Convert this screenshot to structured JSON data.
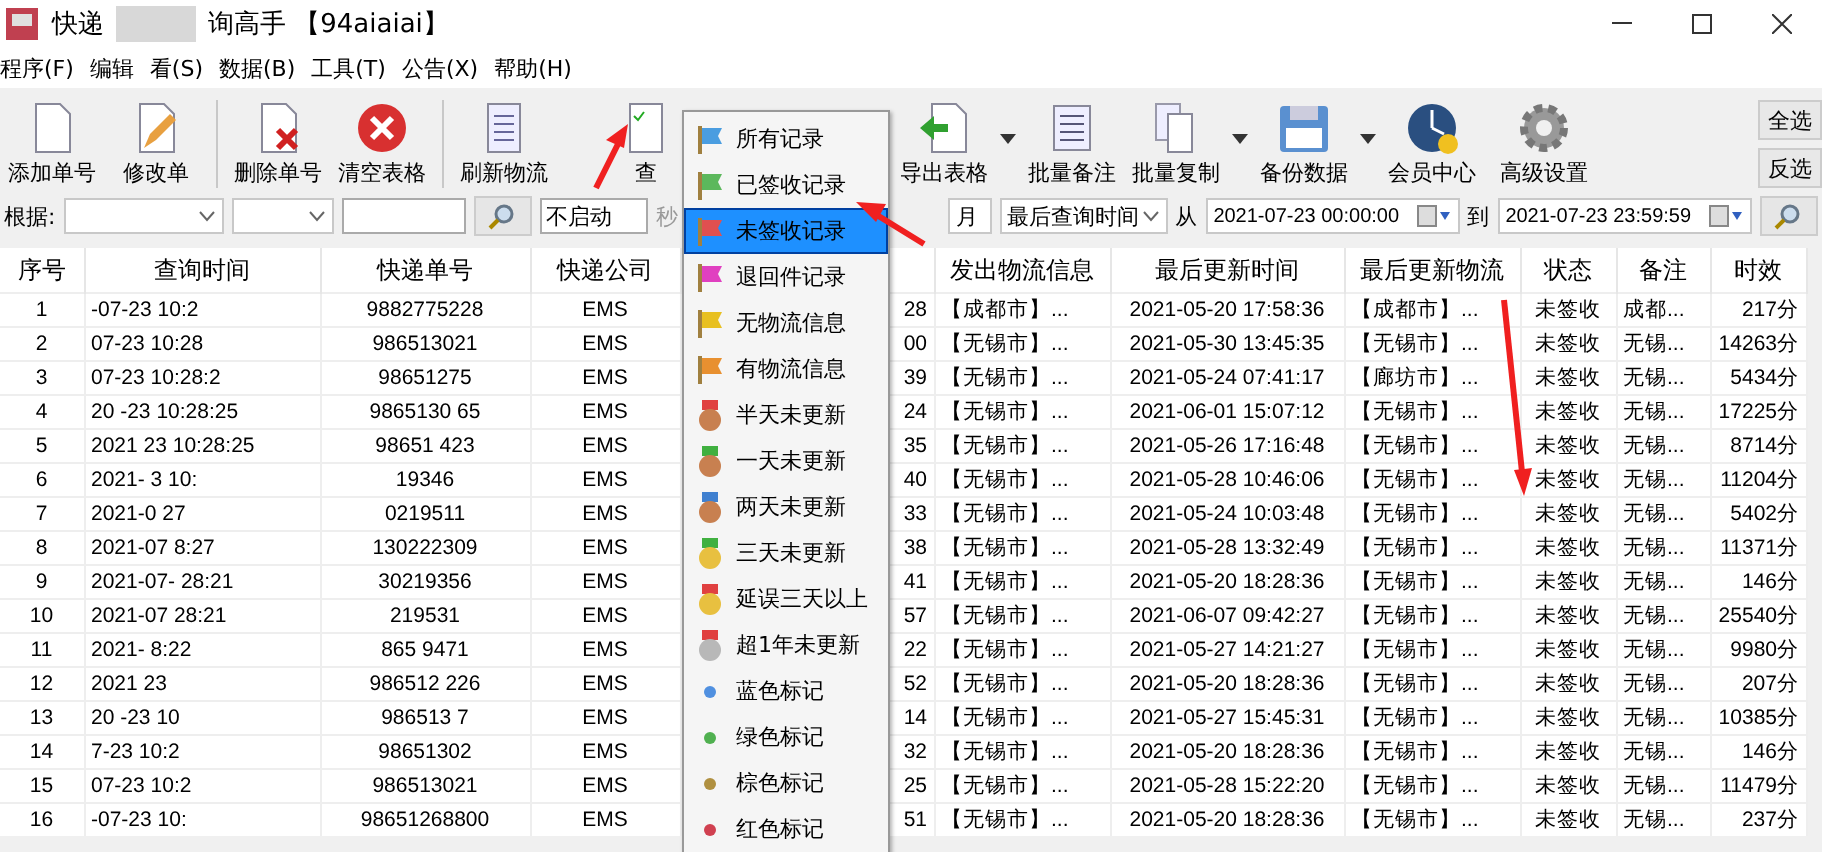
{
  "window": {
    "title_left": "快递",
    "title_right": "询高手 【94aiaiai】"
  },
  "menu_bar": [
    "程序(F)",
    "编辑",
    "看(S)",
    "数据(B)",
    "工具(T)",
    "公告(X)",
    "帮助(H)"
  ],
  "toolbar": {
    "buttons": [
      {
        "kind": "page",
        "label": "添加单号",
        "dropdown": false
      },
      {
        "kind": "edit",
        "label": "修改单",
        "dropdown": false
      },
      {
        "kind": "separator"
      },
      {
        "kind": "delete",
        "label": "删除单号",
        "dropdown": false
      },
      {
        "kind": "clear",
        "label": "清空表格",
        "dropdown": false
      },
      {
        "kind": "separator"
      },
      {
        "kind": "list",
        "label": "刷新物流",
        "dropdown": false
      },
      {
        "kind": "check",
        "label": "查",
        "dropdown": false
      },
      {
        "kind": "export",
        "label": "导出表格",
        "dropdown": true
      },
      {
        "kind": "scroll",
        "label": "批量备注",
        "dropdown": false
      },
      {
        "kind": "copy",
        "label": "批量复制",
        "dropdown": true
      },
      {
        "kind": "save",
        "label": "备份数据",
        "dropdown": true
      },
      {
        "kind": "clock",
        "label": "会员中心",
        "dropdown": false
      },
      {
        "kind": "gear",
        "label": "高级设置",
        "dropdown": false
      }
    ],
    "side_buttons": [
      "全选",
      "反选"
    ]
  },
  "filter": {
    "label": "根据:",
    "start_value": "不启动",
    "seconds_label": "秒",
    "month_value": "月",
    "time_field": "最后查询时间",
    "from_label": "从",
    "from_value": "2021-07-23 00:00:00",
    "to_label": "到",
    "to_value": "2021-07-23 23:59:59"
  },
  "table": {
    "columns": [
      "序号",
      "查询时间",
      "快递单号",
      "快递公司",
      "",
      "发出物流信息",
      "最后更新时间",
      "最后更新物流",
      "状态",
      "备注",
      "时效"
    ],
    "rows": [
      [
        "1",
        "-07-23 10:2",
        "9882775228",
        "EMS",
        "28",
        "【成都市】...",
        "2021-05-20 17:58:36",
        "【成都市】...",
        "未签收",
        "成都...",
        "217分"
      ],
      [
        "2",
        "07-23 10:28",
        "986513021",
        "EMS",
        "00",
        "【无锡市】...",
        "2021-05-30 13:45:35",
        "【无锡市】...",
        "未签收",
        "无锡...",
        "14263分"
      ],
      [
        "3",
        "07-23 10:28:2",
        "98651275",
        "EMS",
        "39",
        "【无锡市】...",
        "2021-05-24 07:41:17",
        "【廊坊市】...",
        "未签收",
        "无锡...",
        "5434分"
      ],
      [
        "4",
        "20 -23 10:28:25",
        "9865130 65",
        "EMS",
        "24",
        "【无锡市】...",
        "2021-06-01 15:07:12",
        "【无锡市】...",
        "未签收",
        "无锡...",
        "17225分"
      ],
      [
        "5",
        "2021 23 10:28:25",
        "98651 423",
        "EMS",
        "35",
        "【无锡市】...",
        "2021-05-26 17:16:48",
        "【无锡市】...",
        "未签收",
        "无锡...",
        "8714分"
      ],
      [
        "6",
        "2021- 3 10:",
        "19346",
        "EMS",
        "40",
        "【无锡市】...",
        "2021-05-28 10:46:06",
        "【无锡市】...",
        "未签收",
        "无锡...",
        "11204分"
      ],
      [
        "7",
        "2021-0 27",
        "0219511",
        "EMS",
        "33",
        "【无锡市】...",
        "2021-05-24 10:03:48",
        "【无锡市】...",
        "未签收",
        "无锡...",
        "5402分"
      ],
      [
        "8",
        "2021-07 8:27",
        "130222309",
        "EMS",
        "38",
        "【无锡市】...",
        "2021-05-28 13:32:49",
        "【无锡市】...",
        "未签收",
        "无锡...",
        "11371分"
      ],
      [
        "9",
        "2021-07- 28:21",
        "30219356",
        "EMS",
        "41",
        "【无锡市】...",
        "2021-05-20 18:28:36",
        "【无锡市】...",
        "未签收",
        "无锡...",
        "146分"
      ],
      [
        "10",
        "2021-07 28:21",
        "219531",
        "EMS",
        "57",
        "【无锡市】...",
        "2021-06-07 09:42:27",
        "【无锡市】...",
        "未签收",
        "无锡...",
        "25540分"
      ],
      [
        "11",
        "2021- 8:22",
        "865 9471",
        "EMS",
        "22",
        "【无锡市】...",
        "2021-05-27 14:21:27",
        "【无锡市】...",
        "未签收",
        "无锡...",
        "9980分"
      ],
      [
        "12",
        "2021 23",
        "986512 226",
        "EMS",
        "52",
        "【无锡市】...",
        "2021-05-20 18:28:36",
        "【无锡市】...",
        "未签收",
        "无锡...",
        "207分"
      ],
      [
        "13",
        "20 -23 10",
        "986513 7",
        "EMS",
        "14",
        "【无锡市】...",
        "2021-05-27 15:45:31",
        "【无锡市】...",
        "未签收",
        "无锡...",
        "10385分"
      ],
      [
        "14",
        "7-23 10:2",
        "98651302",
        "EMS",
        "32",
        "【无锡市】...",
        "2021-05-20 18:28:36",
        "【无锡市】...",
        "未签收",
        "无锡...",
        "146分"
      ],
      [
        "15",
        "07-23 10:2",
        "986513021",
        "EMS",
        "25",
        "【无锡市】...",
        "2021-05-28 15:22:20",
        "【无锡市】...",
        "未签收",
        "无锡...",
        "11479分"
      ],
      [
        "16",
        "-07-23 10:",
        "98651268800",
        "EMS",
        "51",
        "【无锡市】...",
        "2021-05-20 18:28:36",
        "【无锡市】...",
        "未签收",
        "无锡...",
        "237分"
      ]
    ]
  },
  "context_menu": {
    "items": [
      {
        "kind": "flag",
        "label": "所有记录",
        "color": "#4a9de0",
        "selected": false
      },
      {
        "kind": "flag",
        "label": "已签收记录",
        "color": "#5cb85c",
        "selected": false
      },
      {
        "kind": "flag",
        "label": "未签收记录",
        "color": "#e05050",
        "selected": true
      },
      {
        "kind": "flag",
        "label": "退回件记录",
        "color": "#e040c0",
        "selected": false
      },
      {
        "kind": "flag",
        "label": "无物流信息",
        "color": "#e8c020",
        "selected": false
      },
      {
        "kind": "flag",
        "label": "有物流信息",
        "color": "#e89030",
        "selected": false
      },
      {
        "kind": "medal",
        "label": "半天未更新",
        "color": "#c88050",
        "ribbon": {
          "color": "#e04040"
        },
        "selected": false
      },
      {
        "kind": "medal",
        "label": "一天未更新",
        "color": "#c88050",
        "ribbon": {
          "color": "#40b040"
        },
        "selected": false
      },
      {
        "kind": "medal",
        "label": "两天未更新",
        "color": "#c88050",
        "ribbon": {
          "color": "#4080d0"
        },
        "selected": false
      },
      {
        "kind": "medal",
        "label": "三天未更新",
        "color": "#e8c040",
        "ribbon": {
          "color": "#40b040"
        },
        "selected": false
      },
      {
        "kind": "medal",
        "label": "延误三天以上",
        "color": "#e8c040",
        "ribbon": {
          "color": "#e04040"
        },
        "selected": false
      },
      {
        "kind": "medal",
        "label": "超1年未更新",
        "color": "#b8b8b8",
        "ribbon": {
          "color": "#e04040"
        },
        "selected": false
      },
      {
        "kind": "dot",
        "label": "蓝色标记",
        "color": "#5090e0",
        "selected": false
      },
      {
        "kind": "dot",
        "label": "绿色标记",
        "color": "#50b050",
        "selected": false
      },
      {
        "kind": "dot",
        "label": "棕色标记",
        "color": "#b09040",
        "selected": false
      },
      {
        "kind": "dot",
        "label": "红色标记",
        "color": "#d04050",
        "selected": false
      }
    ]
  }
}
